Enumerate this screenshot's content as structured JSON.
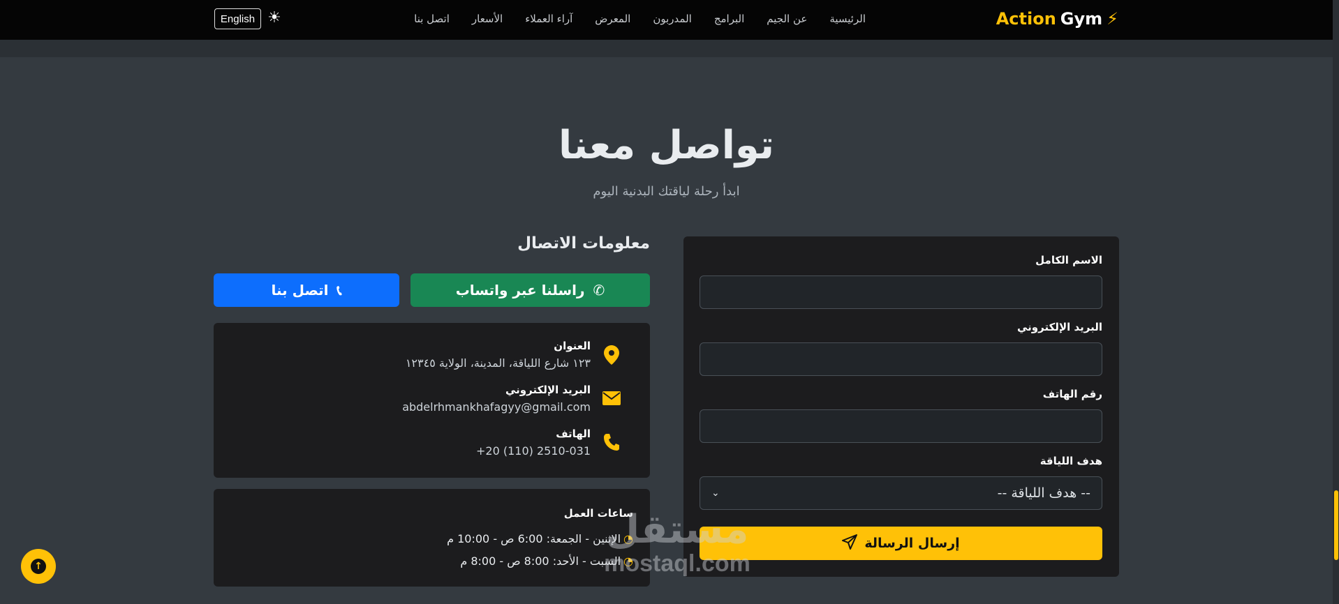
{
  "navbar": {
    "brand_action": "Action",
    "brand_gym": "Gym",
    "links": [
      "الرئيسية",
      "عن الجيم",
      "البرامج",
      "المدربون",
      "المعرض",
      "آراء العملاء",
      "الأسعار",
      "اتصل بنا"
    ],
    "language_button": "English",
    "theme_icon": "sun-icon"
  },
  "header": {
    "title": "تواصل معنا",
    "subtitle": "ابدأ رحلة لياقتك البدنية اليوم"
  },
  "contact_info": {
    "heading": "معلومات الاتصال",
    "whatsapp_button": "راسلنا عبر واتساب",
    "call_button": "اتصل بنا",
    "items": [
      {
        "label": "العنوان",
        "value": "١٢٣ شارع اللياقة، المدينة، الولاية ١٢٣٤٥",
        "icon": "map-pin-icon"
      },
      {
        "label": "البريد الإلكتروني",
        "value": "abdelrhmankhafagyy@gmail.com",
        "icon": "envelope-icon"
      },
      {
        "label": "الهاتف",
        "value": "+20 (110) 2510-031",
        "icon": "phone-icon"
      }
    ]
  },
  "working_hours": {
    "title": "ساعات العمل",
    "rows": [
      "الإثنين - الجمعة: 6:00 ص - 10:00 م",
      "السبت - الأحد: 8:00 ص - 8:00 م"
    ]
  },
  "form": {
    "name_label": "الاسم الكامل",
    "email_label": "البريد الإلكتروني",
    "phone_label": "رقم الهاتف",
    "goal_label": "هدف اللياقة",
    "goal_selected": "-- هدف اللياقة --",
    "submit_label": "إرسال الرسالة"
  },
  "watermark": {
    "arabic": "مستقل",
    "latin": "mostaql.com"
  },
  "colors": {
    "accent": "#ffc107",
    "whatsapp": "#198754",
    "call": "#0d6efd",
    "background": "#343a40",
    "card": "#1c1c1e"
  }
}
